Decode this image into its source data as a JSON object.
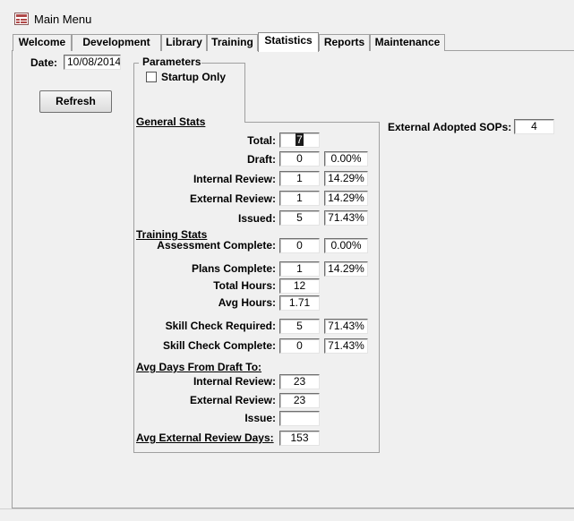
{
  "window": {
    "title": "Main Menu"
  },
  "tabs": [
    {
      "label": "Welcome",
      "active": false
    },
    {
      "label": "Development",
      "active": false
    },
    {
      "label": "Library",
      "active": false
    },
    {
      "label": "Training",
      "active": false
    },
    {
      "label": "Statistics",
      "active": true
    },
    {
      "label": "Reports",
      "active": false
    },
    {
      "label": "Maintenance",
      "active": false
    }
  ],
  "date": {
    "label": "Date:",
    "value": "10/08/2014"
  },
  "refresh_label": "Refresh",
  "parameters": {
    "title": "Parameters",
    "startup_only_label": "Startup Only",
    "startup_only_checked": false
  },
  "general": {
    "heading": "General Stats",
    "total": {
      "label": "Total:",
      "value": "7"
    },
    "draft": {
      "label": "Draft:",
      "value": "0",
      "pct": "0.00%"
    },
    "internal_review": {
      "label": "Internal Review:",
      "value": "1",
      "pct": "14.29%"
    },
    "external_review": {
      "label": "External Review:",
      "value": "1",
      "pct": "14.29%"
    },
    "issued": {
      "label": "Issued:",
      "value": "5",
      "pct": "71.43%"
    }
  },
  "training": {
    "heading": "Training Stats",
    "assessment_complete": {
      "label": "Assessment Complete:",
      "value": "0",
      "pct": "0.00%"
    },
    "plans_complete": {
      "label": "Plans Complete:",
      "value": "1",
      "pct": "14.29%"
    },
    "total_hours": {
      "label": "Total Hours:",
      "value": "12"
    },
    "avg_hours": {
      "label": "Avg Hours:",
      "value": "1.71"
    },
    "skill_check_required": {
      "label": "Skill Check Required:",
      "value": "5",
      "pct": "71.43%"
    },
    "skill_check_complete": {
      "label": "Skill Check Complete:",
      "value": "0",
      "pct": "71.43%"
    }
  },
  "avg_days": {
    "heading": "Avg Days From Draft To:",
    "internal_review": {
      "label": "Internal Review:",
      "value": "23"
    },
    "external_review": {
      "label": "External Review:",
      "value": "23"
    },
    "issue": {
      "label": "Issue:",
      "value": ""
    }
  },
  "avg_external_review_days": {
    "label": "Avg External Review Days:",
    "value": "153"
  },
  "external_adopted_sops": {
    "label": "External Adopted SOPs:",
    "value": "4"
  },
  "colors": {
    "background": "#f0f0f0",
    "field_bg": "#ffffff",
    "border": "#a0a0a0"
  }
}
